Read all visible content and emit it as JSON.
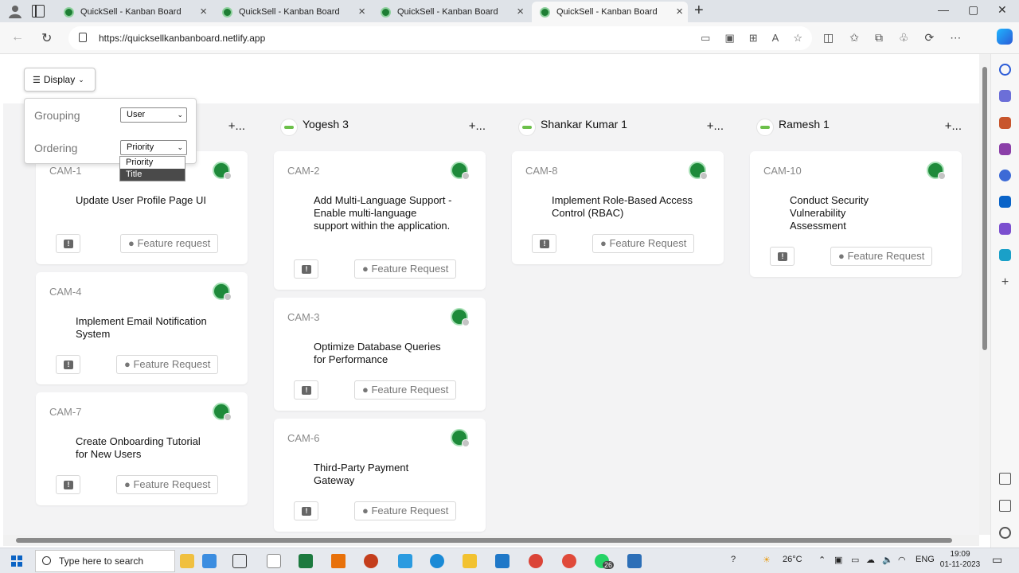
{
  "browser": {
    "tabs": [
      {
        "title": "QuickSell - Kanban Board"
      },
      {
        "title": "QuickSell - Kanban Board"
      },
      {
        "title": "QuickSell - Kanban Board"
      },
      {
        "title": "QuickSell - Kanban Board"
      }
    ],
    "url": "https://quicksellkanbanboard.netlify.app"
  },
  "toolbar": {
    "display_label": "Display"
  },
  "display_menu": {
    "grouping_label": "Grouping",
    "grouping_value": "User",
    "ordering_label": "Ordering",
    "ordering_value": "Priority",
    "ordering_options": [
      "Priority",
      "Title"
    ],
    "highlighted_option": "Title"
  },
  "board": {
    "columns": [
      {
        "name": "",
        "add_label": "+...",
        "cards": [
          {
            "id": "CAM-1",
            "title": "Update User Profile Page UI",
            "tag": "Feature request"
          },
          {
            "id": "CAM-4",
            "title": "Implement Email Notification System",
            "tag": "Feature Request"
          },
          {
            "id": "CAM-7",
            "title": "Create Onboarding Tutorial for New Users",
            "tag": "Feature Request"
          }
        ]
      },
      {
        "name": "Yogesh 3",
        "add_label": "+...",
        "cards": [
          {
            "id": "CAM-2",
            "title": "Add Multi-Language Support - Enable multi-language support within the application.",
            "tag": "Feature Request"
          },
          {
            "id": "CAM-3",
            "title": "Optimize Database Queries for Performance",
            "tag": "Feature Request"
          },
          {
            "id": "CAM-6",
            "title": "Third-Party Payment Gateway",
            "tag": "Feature Request"
          }
        ]
      },
      {
        "name": "Shankar Kumar 1",
        "add_label": "+...",
        "cards": [
          {
            "id": "CAM-8",
            "title": "Implement Role-Based Access Control (RBAC)",
            "tag": "Feature Request"
          }
        ]
      },
      {
        "name": "Ramesh 1",
        "add_label": "+...",
        "cards": [
          {
            "id": "CAM-10",
            "title": "Conduct Security Vulnerability Assessment",
            "tag": "Feature Request"
          }
        ]
      }
    ]
  },
  "taskbar": {
    "search_placeholder": "Type here to search",
    "weather": "26°C",
    "language": "ENG",
    "time": "19:09",
    "date": "01-11-2023",
    "whatsapp_badge": "26"
  }
}
